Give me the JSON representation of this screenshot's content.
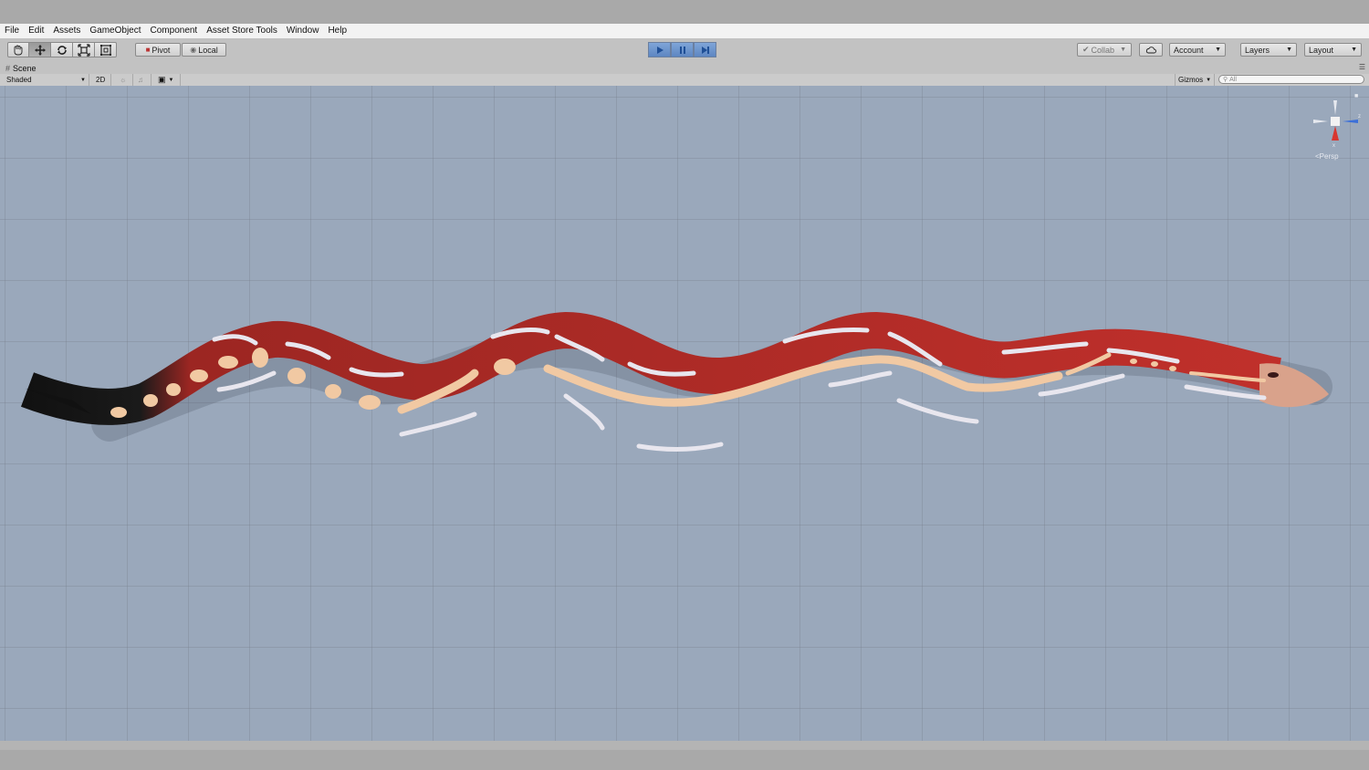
{
  "menu": [
    "File",
    "Edit",
    "Assets",
    "GameObject",
    "Component",
    "Asset Store Tools",
    "Window",
    "Help"
  ],
  "toolbar": {
    "tools": [
      {
        "icon": "hand-icon",
        "active": false
      },
      {
        "icon": "move-icon",
        "active": true
      },
      {
        "icon": "rotate-icon",
        "active": false
      },
      {
        "icon": "scale-icon",
        "active": false
      },
      {
        "icon": "rect-icon",
        "active": false
      }
    ],
    "pivot_label": "Pivot",
    "local_label": "Local",
    "play_buttons": [
      "play-icon",
      "pause-icon",
      "step-icon"
    ],
    "collab_label": "Collab",
    "account_label": "Account",
    "layers_label": "Layers",
    "layout_label": "Layout"
  },
  "scene": {
    "tab_label": "Scene",
    "shading_mode": "Shaded",
    "mode_2d": "2D",
    "gizmos_label": "Gizmos",
    "search_placeholder": "All",
    "view_label": "Persp",
    "gizmo_axes": {
      "x": "x",
      "z": "z"
    }
  },
  "colors": {
    "viewport_bg": "#9aa8bb",
    "snake_body": "#c0302b",
    "snake_pattern": "#f1c9a3",
    "snake_white": "#e8e6ee",
    "play_blue": "#5d86c2"
  },
  "statusbar": {
    "text": ""
  }
}
